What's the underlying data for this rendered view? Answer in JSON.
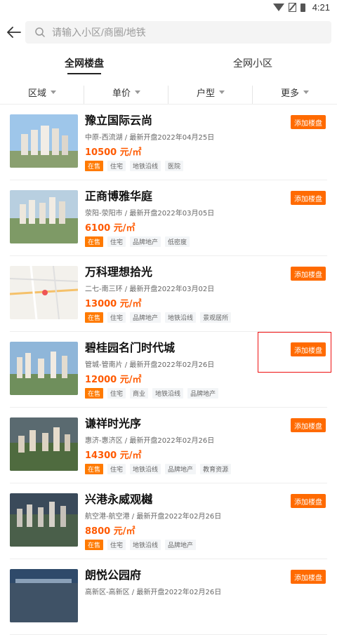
{
  "status": {
    "time": "4:21"
  },
  "search": {
    "placeholder": "请输入小区/商圈/地铁"
  },
  "tabs": [
    {
      "label": "全网楼盘"
    },
    {
      "label": "全网小区"
    }
  ],
  "filters": [
    {
      "label": "区域"
    },
    {
      "label": "单价"
    },
    {
      "label": "户型"
    },
    {
      "label": "更多"
    }
  ],
  "add_label": "添加楼盘",
  "listings": [
    {
      "name": "豫立国际云尚",
      "meta": "中原-西流湖 / 最新开盘2022年04月25日",
      "price": "10500 元/㎡",
      "tags": [
        "在售",
        "住宅",
        "地铁沿线",
        "医院"
      ]
    },
    {
      "name": "正商博雅华庭",
      "meta": "荥阳-荥阳市 / 最新开盘2022年03月05日",
      "price": "6100 元/㎡",
      "tags": [
        "在售",
        "住宅",
        "品牌地产",
        "低密度"
      ]
    },
    {
      "name": "万科理想拾光",
      "meta": "二七-南三环 / 最新开盘2022年03月02日",
      "price": "13000 元/㎡",
      "tags": [
        "在售",
        "住宅",
        "品牌地产",
        "地铁沿线",
        "景观居所"
      ]
    },
    {
      "name": "碧桂园名门时代城",
      "meta": "管城-管南片 / 最新开盘2022年02月26日",
      "price": "12000 元/㎡",
      "tags": [
        "在售",
        "住宅",
        "商业",
        "地铁沿线",
        "品牌地产"
      ]
    },
    {
      "name": "谦祥时光序",
      "meta": "惠济-惠济区 / 最新开盘2022年02月26日",
      "price": "14300 元/㎡",
      "tags": [
        "在售",
        "住宅",
        "地铁沿线",
        "品牌地产",
        "教育资源"
      ]
    },
    {
      "name": "兴港永威观樾",
      "meta": "航空港-航空港 / 最新开盘2022年02月26日",
      "price": "8800 元/㎡",
      "tags": [
        "在售",
        "住宅",
        "地铁沿线",
        "品牌地产"
      ]
    },
    {
      "name": "朗悦公园府",
      "meta": "高新区-高新区 / 最新开盘2022年02月26日",
      "price": "",
      "tags": []
    }
  ]
}
